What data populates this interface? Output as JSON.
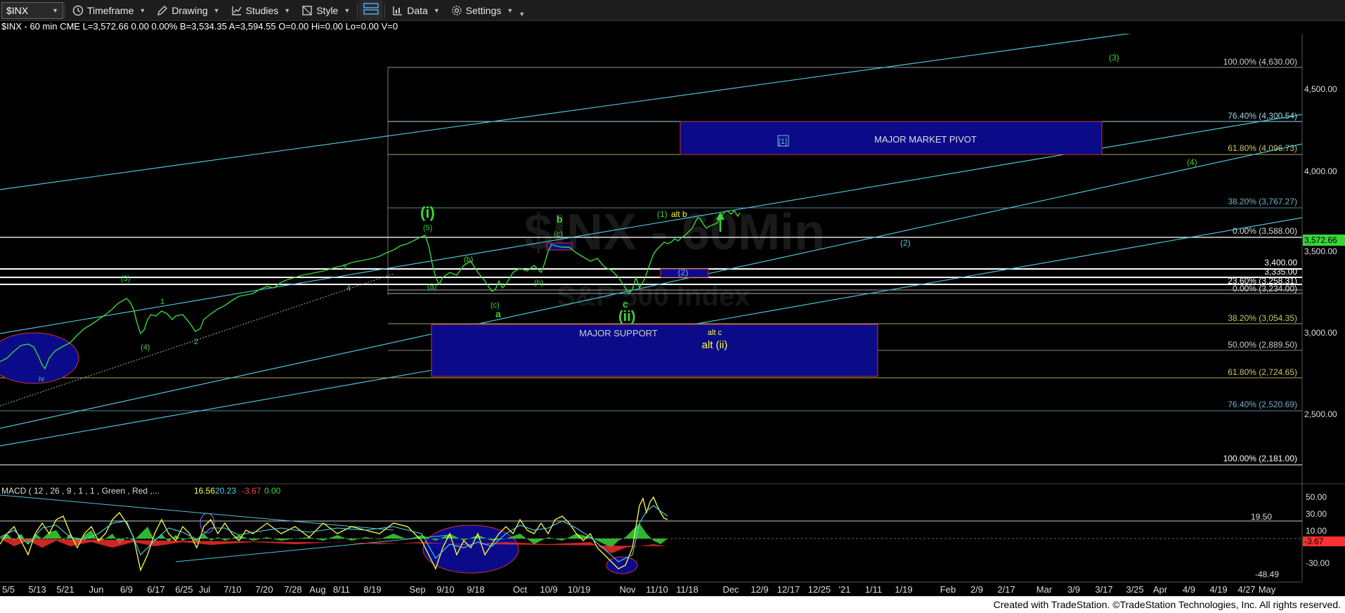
{
  "toolbar": {
    "symbol": "$INX",
    "timeframe": "Timeframe",
    "drawing": "Drawing",
    "studies": "Studies",
    "style": "Style",
    "data": "Data",
    "settings": "Settings"
  },
  "infobar": {
    "text": "$INX - 60 min  CME   L=3,572.66  0.00  0.00%  B=3,534.35  A=3,594.55  O=0.00  Hi=0.00  Lo=0.00  V=0"
  },
  "watermark": {
    "line1": "$INX - 60Min",
    "line2": "S&P 500 Index"
  },
  "price_axis": {
    "labels": [
      "4,500.00",
      "4,000.00",
      "3,500.00",
      "3,000.00",
      "2,500.00"
    ],
    "last_price": "3,572.66"
  },
  "fib_labels": [
    {
      "text": "100.00% (4,630.00)",
      "color": "#cccccc"
    },
    {
      "text": "76.40% (4,300.54)",
      "color": "#9fd7e6"
    },
    {
      "text": "61.80% (4,096.73)",
      "color": "#c8c86a"
    },
    {
      "text": "38.20% (3,767.27)",
      "color": "#6fb3c8"
    },
    {
      "text": "0.00% (3,588.00)",
      "color": "#dddddd"
    },
    {
      "text": "3,400.00",
      "color": "#ffffff"
    },
    {
      "text": "3,335.00",
      "color": "#ffffff"
    },
    {
      "text": "23.60% (3,258.31)",
      "color": "#ffffff"
    },
    {
      "text": "0.00% (3,234.00)",
      "color": "#dddddd"
    },
    {
      "text": "38.20% (3,054.35)",
      "color": "#c8c86a"
    },
    {
      "text": "50.00% (2,889.50)",
      "color": "#cccccc"
    },
    {
      "text": "61.80% (2,724.65)",
      "color": "#c8c86a"
    },
    {
      "text": "76.40% (2,520.69)",
      "color": "#6fb3c8"
    },
    {
      "text": "100.00% (2,181.00)",
      "color": "#ffffff"
    }
  ],
  "zones": {
    "pivot": "MAJOR MARKET PIVOT",
    "pivot_tag": "[1]",
    "support": "MAJOR SUPPORT",
    "alt_c": "alt c",
    "alt_ii": "alt (ii)"
  },
  "wave_labels": {
    "w3": "(3)",
    "w4": "(4)",
    "w2cyan": "(2)",
    "wi": "(i)",
    "w5": "(5)",
    "wb": "b",
    "wc": "(c)",
    "w1": "(1)",
    "altb": "alt b",
    "w2box": "(2)",
    "wa": "(a)",
    "wb2": "(b)",
    "wc2": "(c)",
    "wa2": "a",
    "wb3": "(b)",
    "wc3": "c",
    "wii": "(ii)",
    "w3left": "(3)",
    "w1left": "1",
    "w4left": "(4)",
    "w2left": "2",
    "w3small": "3",
    "w4small": "4",
    "wiv": "iv"
  },
  "macd": {
    "title": "MACD ( 12 , 26 , 9 , 1 , 1 , Green , Red ,...",
    "v1": "16.56",
    "v2": "20.23",
    "v3": "-3.67",
    "v4": "0.00",
    "axis": [
      "50.00",
      "30.00",
      "19.50",
      "10.00",
      "-3.67",
      "-30.00",
      "-48.49"
    ]
  },
  "date_axis": [
    "5/5",
    "5/13",
    "5/21",
    "Jun",
    "6/9",
    "6/17",
    "6/25",
    "Jul",
    "7/10",
    "7/20",
    "7/28",
    "Aug",
    "8/11",
    "8/19",
    "Sep",
    "9/10",
    "9/18",
    "Oct",
    "10/9",
    "10/19",
    "Nov",
    "11/10",
    "11/18",
    "Dec",
    "12/9",
    "12/17",
    "12/25",
    "'21",
    "1/11",
    "1/19",
    "Feb",
    "2/9",
    "2/17",
    "Mar",
    "3/9",
    "3/17",
    "3/25",
    "Apr",
    "4/9",
    "4/19",
    "4/27",
    "May"
  ],
  "footer": "Created with TradeStation. ©TradeStation Technologies, Inc. All rights reserved."
}
